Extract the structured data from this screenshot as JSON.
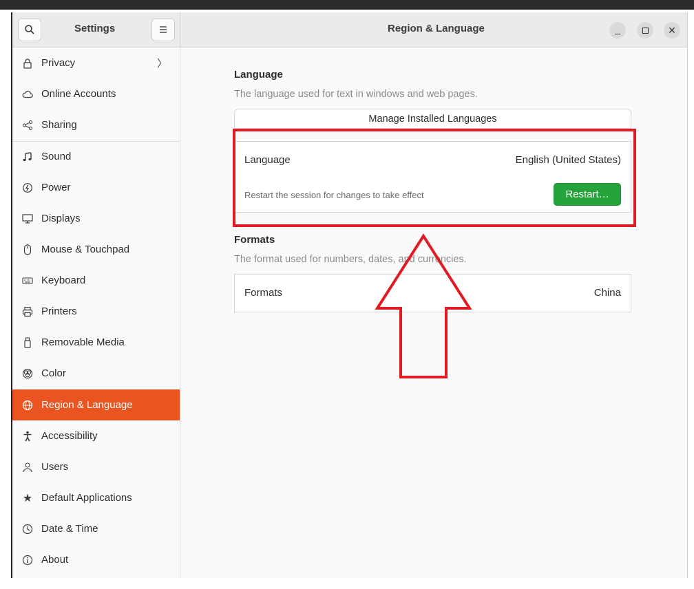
{
  "window": {
    "sidebar_title": "Settings",
    "panel_title": "Region & Language"
  },
  "sidebar": {
    "items": [
      {
        "label": "Privacy",
        "icon": "lock-icon"
      },
      {
        "label": "Online Accounts",
        "icon": "cloud-icon"
      },
      {
        "label": "Sharing",
        "icon": "share-icon"
      },
      {
        "label": "Sound",
        "icon": "music-note-icon"
      },
      {
        "label": "Power",
        "icon": "power-icon"
      },
      {
        "label": "Displays",
        "icon": "display-icon"
      },
      {
        "label": "Mouse & Touchpad",
        "icon": "mouse-icon"
      },
      {
        "label": "Keyboard",
        "icon": "keyboard-icon"
      },
      {
        "label": "Printers",
        "icon": "printer-icon"
      },
      {
        "label": "Removable Media",
        "icon": "usb-icon"
      },
      {
        "label": "Color",
        "icon": "color-icon"
      },
      {
        "label": "Region & Language",
        "icon": "globe-icon",
        "active": true
      },
      {
        "label": "Accessibility",
        "icon": "accessibility-icon"
      },
      {
        "label": "Users",
        "icon": "users-icon"
      },
      {
        "label": "Default Applications",
        "icon": "star-icon"
      },
      {
        "label": "Date & Time",
        "icon": "clock-icon"
      },
      {
        "label": "About",
        "icon": "info-icon"
      }
    ]
  },
  "language_section": {
    "title": "Language",
    "description": "The language used for text in windows and web pages.",
    "manage_button": "Manage Installed Languages",
    "row_label": "Language",
    "row_value": "English (United States)",
    "restart_notice": "Restart the session for changes to take effect",
    "restart_button": "Restart…"
  },
  "formats_section": {
    "title": "Formats",
    "description": "The format used for numbers, dates, and currencies.",
    "row_label": "Formats",
    "row_value": "China"
  },
  "colors": {
    "accent": "#e95420",
    "restart": "#26a33a",
    "annotation": "#e01b24"
  }
}
